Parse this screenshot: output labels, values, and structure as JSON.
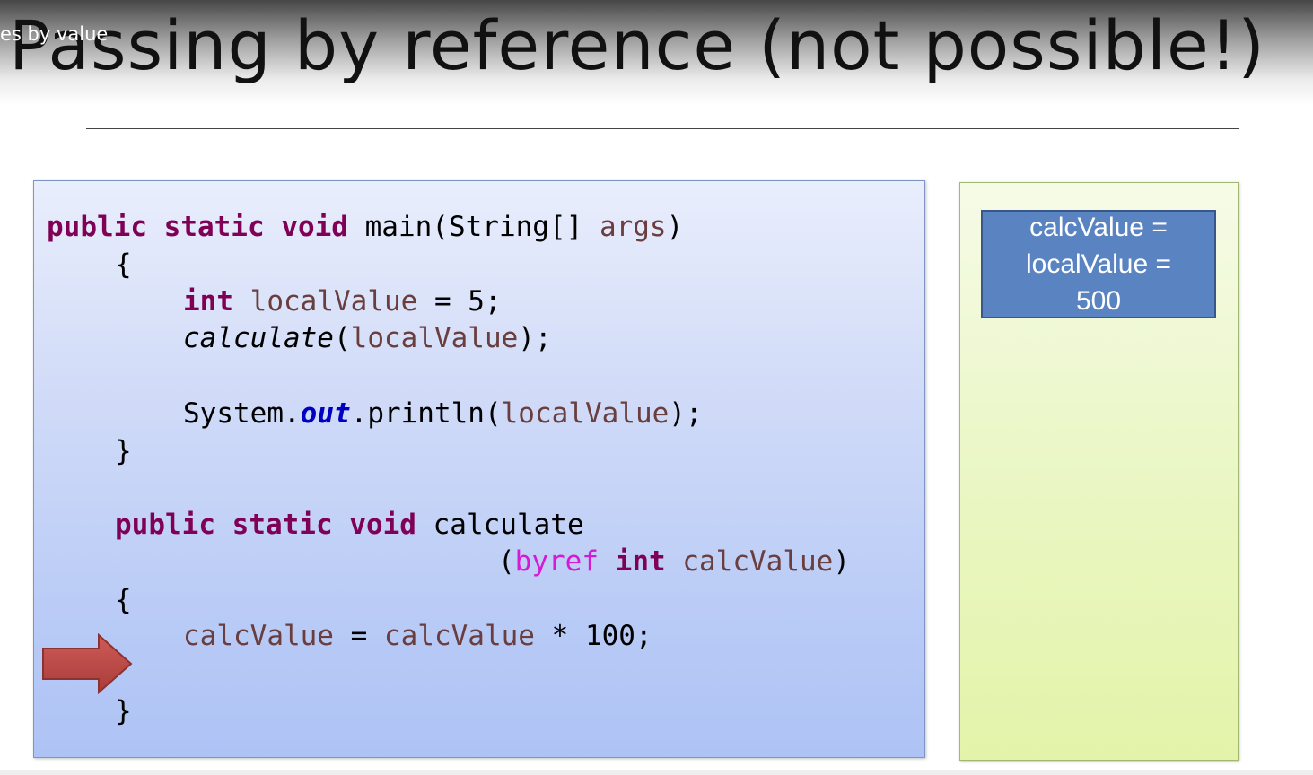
{
  "slide": {
    "title": "Passing by reference (not possible!)",
    "video_caption": "es by value"
  },
  "code": {
    "main_signature": {
      "kw1": "public",
      "kw2": "static",
      "kw3": "void",
      "name": "main(String[] ",
      "param": "args",
      "close": ")"
    },
    "main_open_brace": "{",
    "line_local_decl": {
      "type": "int",
      "var": "localValue",
      "rest": " = 5;"
    },
    "line_call": {
      "method": "calculate",
      "open": "(",
      "arg": "localValue",
      "close": ");"
    },
    "line_print": {
      "prefix": "System.",
      "field": "out",
      "method": ".println(",
      "arg": "localValue",
      "close": ");"
    },
    "main_close_brace": "}",
    "calc_signature": {
      "kw1": "public",
      "kw2": "static",
      "kw3": "void",
      "name": "calculate"
    },
    "calc_params": {
      "open": "(",
      "byref": "byref",
      "type": "int",
      "param": "calcValue",
      "close": ")"
    },
    "calc_open_brace": "{",
    "line_assign": {
      "var": "calcValue",
      "eq": " = ",
      "var2": "calcValue",
      "rest": " * 100;"
    },
    "calc_close_brace": "}"
  },
  "memory": {
    "box_lines": [
      "calcValue =",
      "localValue =",
      "500"
    ]
  },
  "colors": {
    "keyword": "#7f0055",
    "variable": "#6a3e3e",
    "static_field": "#0000c0",
    "byref": "#d41ad4",
    "arrow": "#c0504d",
    "variable_box": "#5a83c2"
  },
  "icons": {
    "current_line_marker": "right-arrow-icon"
  }
}
